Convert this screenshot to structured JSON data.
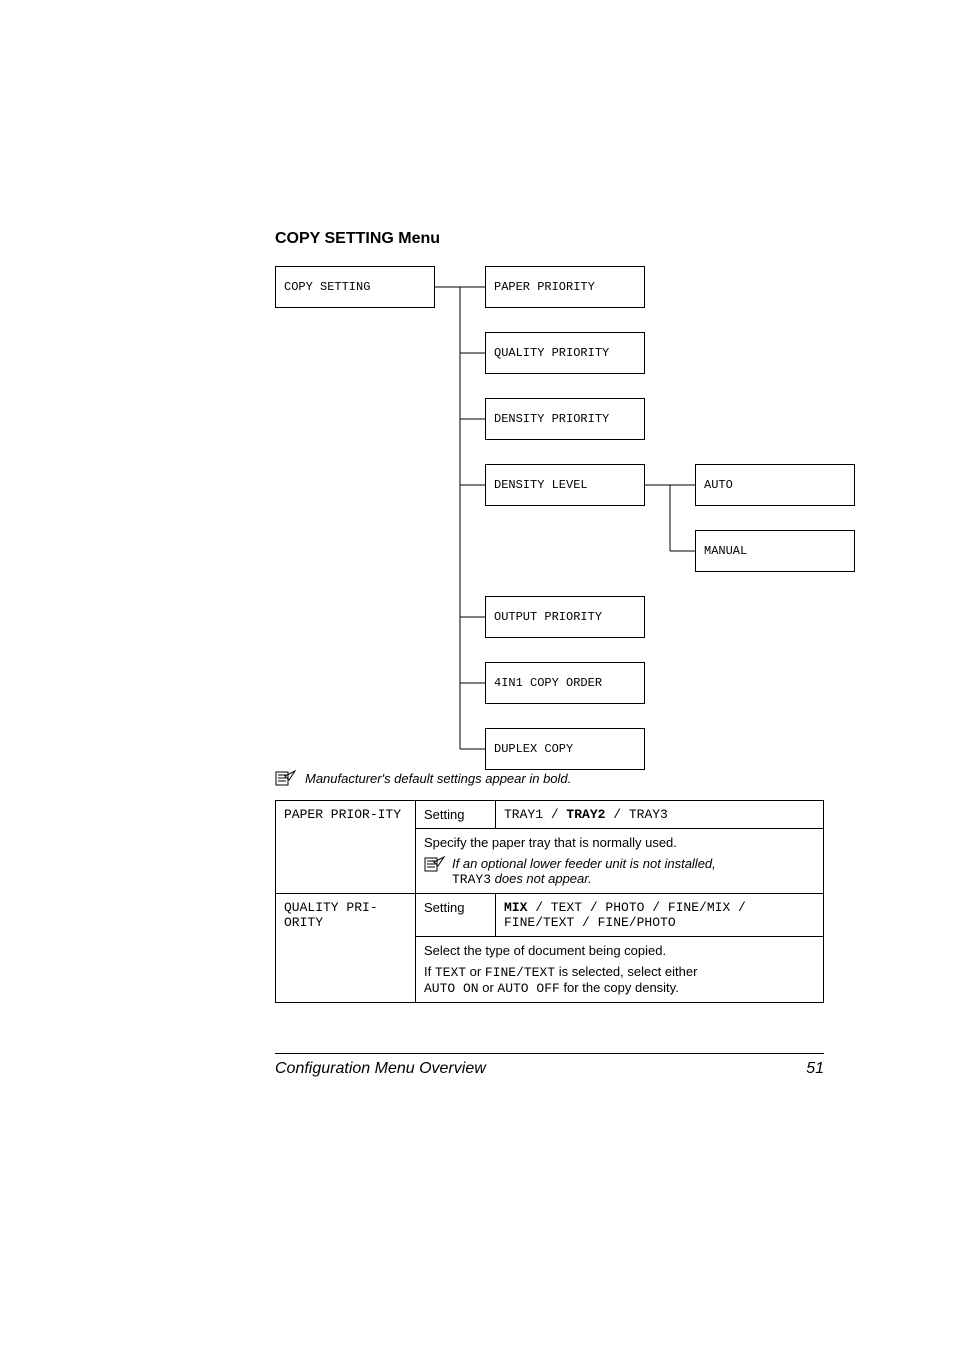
{
  "heading": "COPY SETTING Menu",
  "tree": {
    "root": "COPY SETTING",
    "children": [
      "PAPER PRIORITY",
      "QUALITY PRIORITY",
      "DENSITY PRIORITY",
      "DENSITY LEVEL",
      "OUTPUT PRIORITY",
      "4IN1 COPY ORDER",
      "DUPLEX COPY"
    ],
    "density_level_children": [
      "AUTO",
      "MANUAL"
    ]
  },
  "default_note": "Manufacturer's default settings appear in bold.",
  "table": {
    "paper_priority": {
      "label": "PAPER PRIOR-ITY",
      "setting_label": "Setting",
      "setting_value_pre": "TRAY1",
      "setting_value_bold": "TRAY2",
      "setting_value_post": "TRAY3",
      "desc": "Specify the paper tray that is normally used.",
      "note_line1": "If an optional lower feeder unit is not installed,",
      "note_line2_pre": "TRAY3",
      "note_line2_post": " does not appear."
    },
    "quality_priority": {
      "label": "QUALITY PRI-ORITY",
      "setting_label": "Setting",
      "setting_value_bold": "MIX",
      "setting_value_rest1": " / TEXT / PHOTO / FINE/MIX /",
      "setting_value_rest2": "FINE/TEXT / FINE/PHOTO",
      "desc": "Select the type of document being copied.",
      "note_pre": "If ",
      "note_text": "TEXT",
      "note_mid": " or ",
      "note_finetext": "FINE/TEXT",
      "note_post": " is selected, select either ",
      "note_line2_a": "AUTO ON",
      "note_line2_b": " or ",
      "note_line2_c": "AUTO OFF",
      "note_line2_d": " for the copy density."
    }
  },
  "footer": {
    "title": "Configuration Menu Overview",
    "page": "51"
  }
}
